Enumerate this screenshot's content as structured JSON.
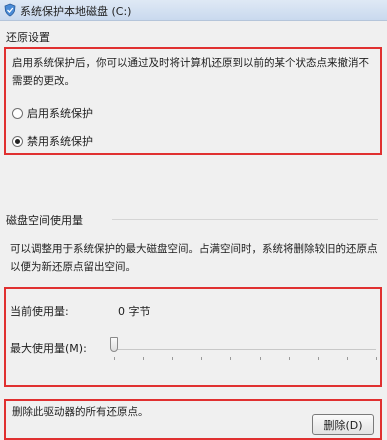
{
  "window": {
    "title": "系统保护本地磁盘 (C:)",
    "icon": "shield-icon"
  },
  "restore_settings": {
    "heading": "还原设置",
    "description": "启用系统保护后，你可以通过及时将计算机还原到以前的某个状态点来撤消不需要的更改。",
    "options": [
      {
        "label": "启用系统保护",
        "checked": false
      },
      {
        "label": "禁用系统保护",
        "checked": true
      }
    ]
  },
  "disk_usage": {
    "heading": "磁盘空间使用量",
    "description": "可以调整用于系统保护的最大磁盘空间。占满空间时，系统将删除较旧的还原点以便为新还原点留出空间。",
    "current_usage_label": "当前使用量:",
    "current_usage_value": "0 字节",
    "max_usage_label": "最大使用量(M):",
    "max_usage_fraction": 0
  },
  "delete": {
    "description": "删除此驱动器的所有还原点。",
    "button_label": "删除(D)"
  },
  "colors": {
    "highlight_box": "#e03030",
    "background": "#f0f0f0"
  }
}
